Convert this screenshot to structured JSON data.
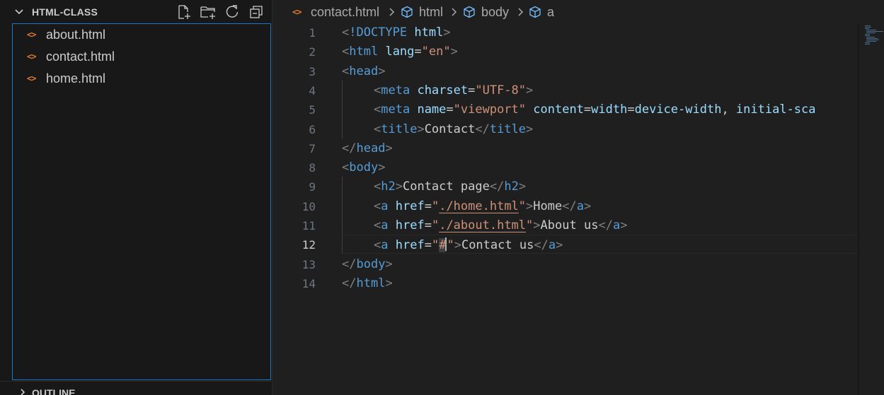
{
  "explorer": {
    "section_title": "HTML-CLASS",
    "header_actions": [
      {
        "name": "new-file-button",
        "icon": "new-file-icon"
      },
      {
        "name": "new-folder-button",
        "icon": "new-folder-icon"
      },
      {
        "name": "refresh-explorer-button",
        "icon": "refresh-icon"
      },
      {
        "name": "collapse-folders-button",
        "icon": "collapse-all-icon"
      }
    ],
    "files": [
      {
        "icon": "<>",
        "name": "about.html"
      },
      {
        "icon": "<>",
        "name": "contact.html"
      },
      {
        "icon": "<>",
        "name": "home.html"
      }
    ],
    "outline_title": "OUTLINE"
  },
  "breadcrumb": {
    "file": "contact.html",
    "file_icon": "<>",
    "symbols": [
      "html",
      "body",
      "a"
    ]
  },
  "editor": {
    "language": "html",
    "current_line": 12,
    "line_numbers": [
      "1",
      "2",
      "3",
      "4",
      "5",
      "6",
      "7",
      "8",
      "9",
      "10",
      "11",
      "12",
      "13",
      "14"
    ],
    "lines": [
      "<!DOCTYPE html>",
      "<html lang=\"en\">",
      "<head>",
      "<meta charset=\"UTF-8\">",
      "<meta name=\"viewport\" content=\"width=device-width, initial-sca",
      "<title>Contact</title>",
      "</head>",
      "<body>",
      "<h2>Contact page</h2>",
      "<a href=\"./home.html\">Home</a>",
      "<a href=\"./about.html\">About us</a>",
      "<a href=\"#\">Contact us</a>",
      "</body>",
      "</html>"
    ]
  },
  "colors": {
    "accent_border": "#1a76c9",
    "html_file_icon": "#e37933",
    "tag": "#569cd6",
    "attribute": "#9cdcfe",
    "string": "#ce9178"
  }
}
